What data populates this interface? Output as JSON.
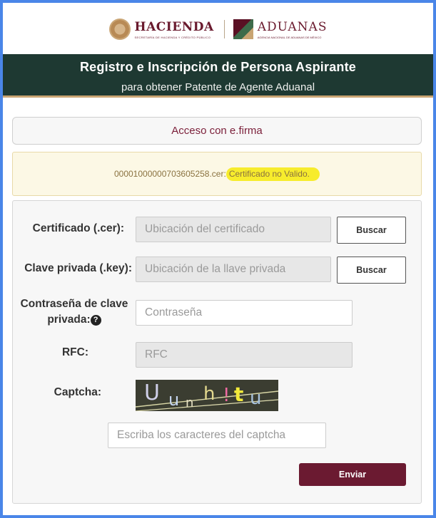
{
  "header": {
    "hacienda_name": "HACIENDA",
    "hacienda_sub": "SECRETARÍA DE HACIENDA Y CRÉDITO PÚBLICO",
    "aduanas_name": "ADUANAS",
    "aduanas_sub": "AGENCIA NACIONAL DE ADUANAS DE MÉXICO"
  },
  "band": {
    "title": "Registro e Inscripción de Persona Aspirante",
    "subtitle": "para obtener Patente de Agente Aduanal"
  },
  "access": {
    "label": "Acceso con e.firma"
  },
  "error": {
    "file": "00001000000703605258.cer:",
    "message": "Certificado no Valido."
  },
  "form": {
    "certificado_label": "Certificado (.cer):",
    "certificado_placeholder": "Ubicación del certificado",
    "clave_label": "Clave privada (.key):",
    "clave_placeholder": "Ubicación de la llave privada",
    "buscar_label": "Buscar",
    "contrasena_label_1": "Contraseña de clave",
    "contrasena_label_2": "privada:",
    "contrasena_placeholder": "Contraseña",
    "rfc_label": "RFC:",
    "rfc_placeholder": "RFC",
    "captcha_label": "Captcha:",
    "captcha_chars": [
      "U",
      "u",
      "n",
      "h",
      "!",
      "t",
      "u"
    ],
    "captcha_placeholder": "Escriba los caracteres del captcha",
    "enviar_label": "Enviar"
  },
  "colors": {
    "brand": "#6b1a31",
    "band": "#1e3932",
    "gold": "#c9a472",
    "frame": "#4a86e8",
    "highlight": "#f7ec2c"
  },
  "icons": {
    "help": "question-circle-icon"
  }
}
